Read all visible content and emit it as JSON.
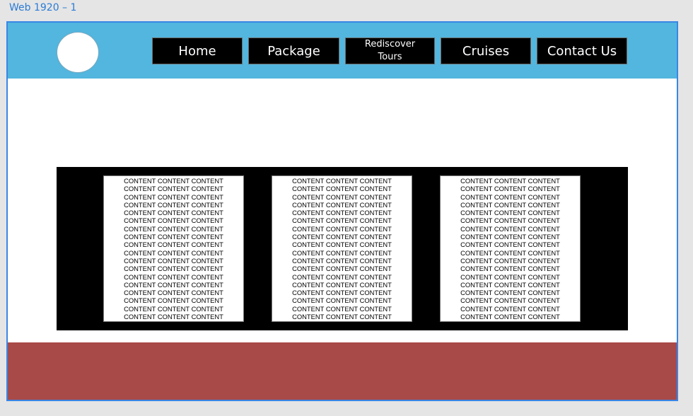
{
  "artboard": {
    "label": "Web 1920 – 1"
  },
  "nav": {
    "items": [
      {
        "label": "Home"
      },
      {
        "label": "Package"
      },
      {
        "label": "Rediscover\nTours"
      },
      {
        "label": "Cruises"
      },
      {
        "label": "Contact Us"
      }
    ]
  },
  "cards": [
    {
      "line_text": "CONTENT CONTENT CONTENT",
      "line_count": 18
    },
    {
      "line_text": "CONTENT CONTENT CONTENT",
      "line_count": 18
    },
    {
      "line_text": "CONTENT CONTENT CONTENT",
      "line_count": 18
    }
  ],
  "colors": {
    "header": "#52b6de",
    "footer": "#a84a48",
    "nav_button": "#000000",
    "artboard_border": "#3a86e6"
  }
}
